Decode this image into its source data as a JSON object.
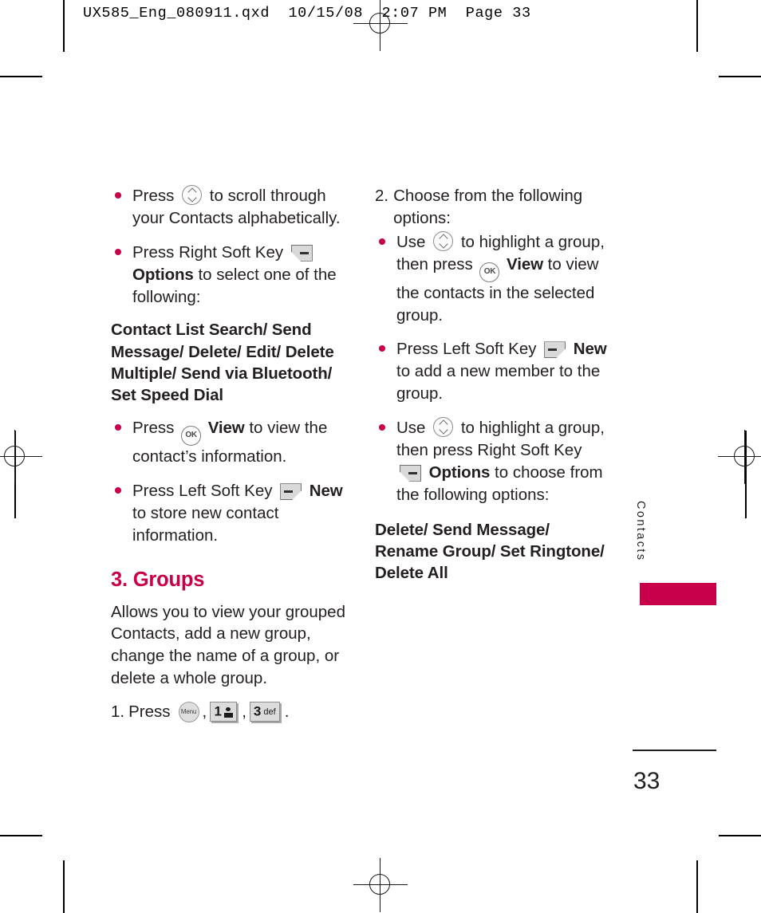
{
  "prepress": {
    "slug": "UX585_Eng_080911.qxd  10/15/08  2:07 PM  Page 33"
  },
  "left_column": {
    "bullets_top": [
      {
        "parts": [
          {
            "t": "text",
            "v": "Press "
          },
          {
            "t": "icon",
            "v": "navigation-key-icon"
          },
          {
            "t": "text",
            "v": " to scroll through your Contacts alphabetically."
          }
        ]
      },
      {
        "parts": [
          {
            "t": "text",
            "v": "Press Right Soft Key "
          },
          {
            "t": "icon",
            "v": "right-soft-key-icon"
          },
          {
            "t": "bold",
            "v": " Options"
          },
          {
            "t": "text",
            "v": " to select one of the following:"
          }
        ]
      }
    ],
    "options_list": "Contact List Search/ Send Message/ Delete/ Edit/ Delete Multiple/ Send via Bluetooth/ Set Speed Dial",
    "bullets_bottom": [
      {
        "parts": [
          {
            "t": "text",
            "v": "Press "
          },
          {
            "t": "icon",
            "v": "ok-key-icon"
          },
          {
            "t": "bold",
            "v": " View"
          },
          {
            "t": "text",
            "v": " to view the contact’s information."
          }
        ]
      },
      {
        "parts": [
          {
            "t": "text",
            "v": "Press Left Soft Key "
          },
          {
            "t": "icon",
            "v": "left-soft-key-icon"
          },
          {
            "t": "bold",
            "v": " New"
          },
          {
            "t": "text",
            "v": " to store new contact information."
          }
        ]
      }
    ],
    "section": {
      "heading": "3. Groups",
      "description": "Allows you to view your grouped Contacts, add a new group, change the name of a group, or delete a whole group.",
      "step": {
        "number": "1.",
        "label": "Press",
        "keys": [
          {
            "type": "menu",
            "label": "Menu"
          },
          {
            "type": "numeric",
            "num": "1",
            "sub": "voicemail-icon"
          },
          {
            "type": "numeric",
            "num": "3",
            "sub": "def"
          }
        ],
        "separator": ",",
        "terminator": "."
      }
    }
  },
  "right_column": {
    "step": {
      "number": "2.",
      "text": "Choose from the following options:"
    },
    "bullets": [
      {
        "parts": [
          {
            "t": "text",
            "v": "Use "
          },
          {
            "t": "icon",
            "v": "navigation-key-icon"
          },
          {
            "t": "text",
            "v": " to highlight a group, then press "
          },
          {
            "t": "icon",
            "v": "ok-key-icon"
          },
          {
            "t": "bold",
            "v": " View"
          },
          {
            "t": "text",
            "v": " to view the contacts in the selected group."
          }
        ]
      },
      {
        "parts": [
          {
            "t": "text",
            "v": "Press Left Soft Key "
          },
          {
            "t": "icon",
            "v": "left-soft-key-icon"
          },
          {
            "t": "bold",
            "v": " New"
          },
          {
            "t": "text",
            "v": " to add a new member to the group."
          }
        ]
      },
      {
        "parts": [
          {
            "t": "text",
            "v": "Use "
          },
          {
            "t": "icon",
            "v": "navigation-key-icon"
          },
          {
            "t": "text",
            "v": " to highlight a group, then press Right Soft Key "
          },
          {
            "t": "icon",
            "v": "right-soft-key-icon"
          },
          {
            "t": "bold",
            "v": " Options"
          },
          {
            "t": "text",
            "v": " to choose from the following options:"
          }
        ]
      }
    ],
    "options_list": "Delete/ Send Message/ Rename Group/ Set Ringtone/ Delete All"
  },
  "side_tab": {
    "label": "Contacts",
    "color": "#c8004b"
  },
  "folio": {
    "page_number": "33"
  },
  "colors": {
    "accent": "#c8004b",
    "text": "#231f20"
  }
}
